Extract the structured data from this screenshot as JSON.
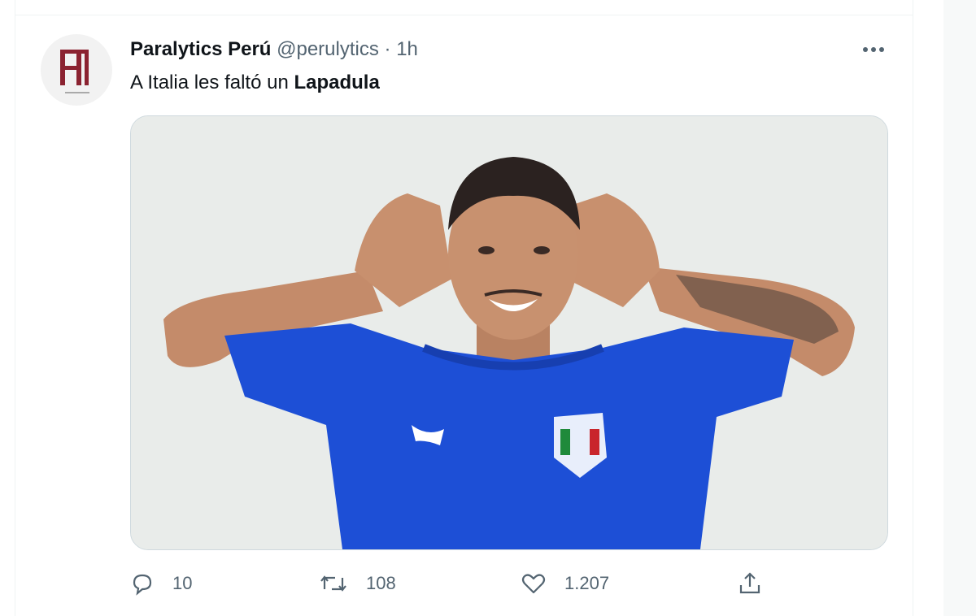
{
  "tweet": {
    "author_name": "Paralytics Perú",
    "author_handle": "@perulytics",
    "separator": "·",
    "time": "1h",
    "text_prefix": "A Italia les faltó un ",
    "text_bold": "Lapadula",
    "avatar_icon": "paralytics-logo",
    "more_icon": "more-dots-icon",
    "media_description_icon": "photo"
  },
  "actions": {
    "reply_count": "10",
    "retweet_count": "108",
    "like_count": "1.207"
  },
  "colors": {
    "text": "#0f1419",
    "secondary": "#536471",
    "border": "#cfd9de",
    "logo": "#8b2331",
    "jersey": "#1d4fd6"
  }
}
